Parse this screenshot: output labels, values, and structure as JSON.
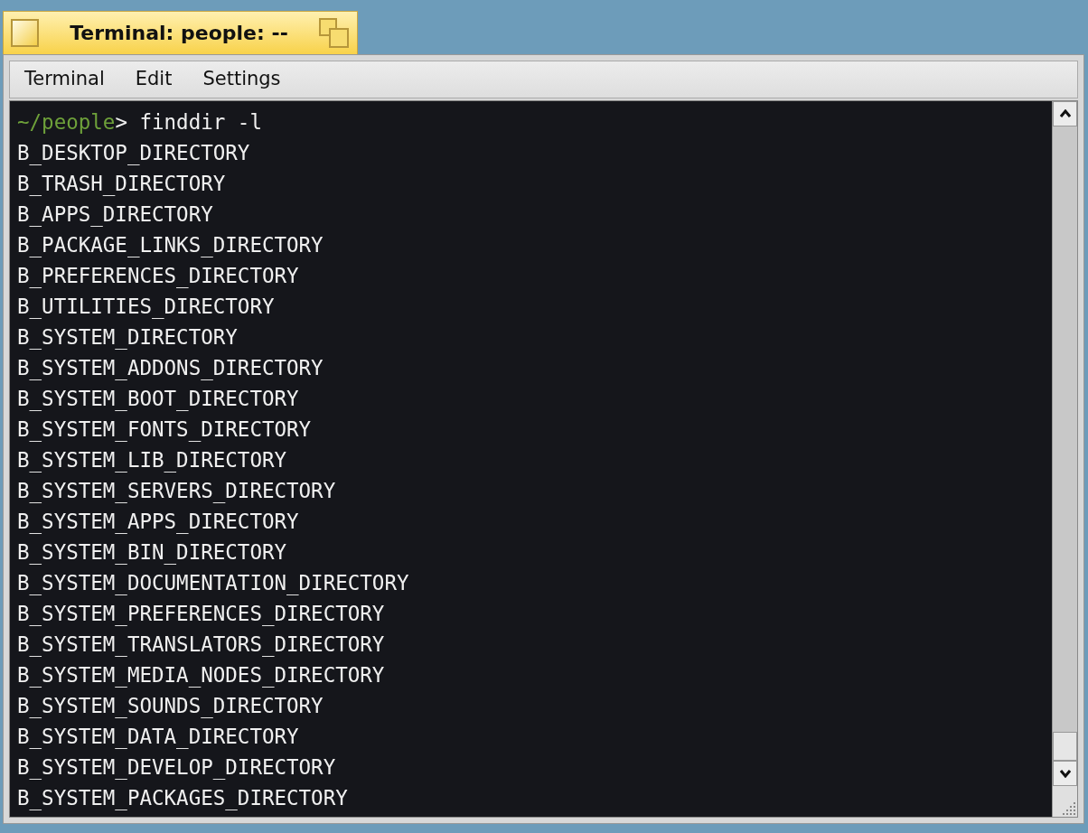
{
  "window": {
    "title": "Terminal: people: --"
  },
  "menu": [
    "Terminal",
    "Edit",
    "Settings"
  ],
  "terminal": {
    "prompt": {
      "path": "~/people",
      "symbol": ">"
    },
    "command": "finddir -l",
    "output": [
      "B_DESKTOP_DIRECTORY",
      "B_TRASH_DIRECTORY",
      "B_APPS_DIRECTORY",
      "B_PACKAGE_LINKS_DIRECTORY",
      "B_PREFERENCES_DIRECTORY",
      "B_UTILITIES_DIRECTORY",
      "B_SYSTEM_DIRECTORY",
      "B_SYSTEM_ADDONS_DIRECTORY",
      "B_SYSTEM_BOOT_DIRECTORY",
      "B_SYSTEM_FONTS_DIRECTORY",
      "B_SYSTEM_LIB_DIRECTORY",
      "B_SYSTEM_SERVERS_DIRECTORY",
      "B_SYSTEM_APPS_DIRECTORY",
      "B_SYSTEM_BIN_DIRECTORY",
      "B_SYSTEM_DOCUMENTATION_DIRECTORY",
      "B_SYSTEM_PREFERENCES_DIRECTORY",
      "B_SYSTEM_TRANSLATORS_DIRECTORY",
      "B_SYSTEM_MEDIA_NODES_DIRECTORY",
      "B_SYSTEM_SOUNDS_DIRECTORY",
      "B_SYSTEM_DATA_DIRECTORY",
      "B_SYSTEM_DEVELOP_DIRECTORY",
      "B_SYSTEM_PACKAGES_DIRECTORY"
    ]
  }
}
